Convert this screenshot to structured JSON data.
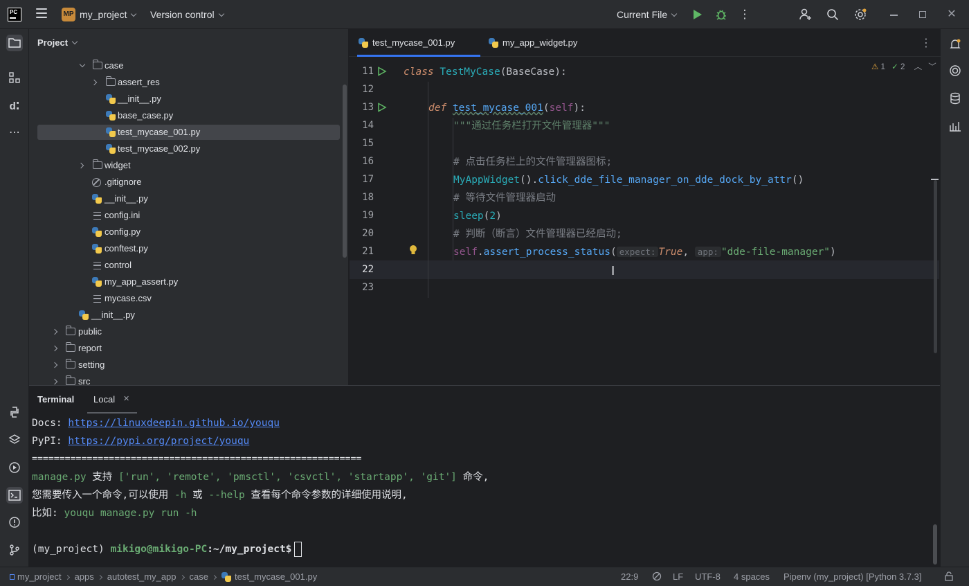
{
  "titlebar": {
    "logo": "PC",
    "project_badge": "MP",
    "project_name": "my_project",
    "vcs": "Version control",
    "run_config": "Current File"
  },
  "project_panel": {
    "title": "Project",
    "items": [
      {
        "label": "case",
        "type": "folder",
        "expanded": true
      },
      {
        "label": "assert_res",
        "type": "folder",
        "expanded": false
      },
      {
        "label": "__init__.py",
        "type": "python"
      },
      {
        "label": "base_case.py",
        "type": "python"
      },
      {
        "label": "test_mycase_001.py",
        "type": "python",
        "selected": true
      },
      {
        "label": "test_mycase_002.py",
        "type": "python"
      },
      {
        "label": "widget",
        "type": "folder",
        "expanded": false
      },
      {
        "label": ".gitignore",
        "type": "ignore"
      },
      {
        "label": "__init__.py",
        "type": "python"
      },
      {
        "label": "config.ini",
        "type": "text"
      },
      {
        "label": "config.py",
        "type": "python"
      },
      {
        "label": "conftest.py",
        "type": "python"
      },
      {
        "label": "control",
        "type": "text"
      },
      {
        "label": "my_app_assert.py",
        "type": "python"
      },
      {
        "label": "mycase.csv",
        "type": "text"
      },
      {
        "label": "__init__.py",
        "type": "python"
      },
      {
        "label": "public",
        "type": "folder",
        "expanded": false
      },
      {
        "label": "report",
        "type": "folder",
        "expanded": false
      },
      {
        "label": "setting",
        "type": "folder",
        "expanded": false
      },
      {
        "label": "src",
        "type": "folder",
        "expanded": false
      }
    ]
  },
  "editor": {
    "tabs": [
      {
        "label": "test_mycase_001.py",
        "active": true
      },
      {
        "label": "my_app_widget.py",
        "active": false
      }
    ],
    "inspection": {
      "warnings": "1",
      "weak_warnings": "2"
    },
    "line_numbers": [
      "11",
      "12",
      "13",
      "14",
      "15",
      "16",
      "17",
      "18",
      "19",
      "20",
      "21",
      "22",
      "23"
    ],
    "code": {
      "l11_kw": "class ",
      "l11_name": "TestMyCase",
      "l11_rest": "(BaseCase):",
      "l13_kw": "def ",
      "l13_name": "test_mycase_001",
      "l13_p1": "(",
      "l13_self": "self",
      "l13_p2": "):",
      "l14_doc": "\"\"\"通过任务栏打开文件管理器\"\"\"",
      "l16_cmt": "# 点击任务栏上的文件管理器图标;",
      "l17_a": "MyAppWidget",
      "l17_b": "().",
      "l17_c": "click_dde_file_manager_on_dde_dock_by_attr",
      "l17_d": "()",
      "l18_cmt": "# 等待文件管理器启动",
      "l19_a": "sleep",
      "l19_b": "(",
      "l19_num": "2",
      "l19_c": ")",
      "l20_cmt": "# 判断（断言）文件管理器已经启动;",
      "l21_self": "self",
      "l21_dot": ".",
      "l21_fn": "assert_process_status",
      "l21_p": "(",
      "l21_hint1": "expect:",
      "l21_true": "True",
      "l21_comma": ", ",
      "l21_hint2": "app:",
      "l21_str": "\"dde-file-manager\"",
      "l21_end": ")"
    }
  },
  "terminal": {
    "tab_terminal": "Terminal",
    "tab_local": "Local",
    "lines": {
      "docs_label": "Docs: ",
      "docs_url": "https://linuxdeepin.github.io/youqu",
      "pypi_label": "PyPI: ",
      "pypi_url": "https://pypi.org/project/youqu",
      "separator": "============================================================",
      "l4_a": "manage.py",
      "l4_b": " 支持 ",
      "l4_c": "['run', 'remote', 'pmsctl', 'csvctl', 'startapp', 'git']",
      "l4_d": " 命令,",
      "l5_a": "您需要传入一个命令,可以使用 ",
      "l5_b": "-h",
      "l5_c": " 或 ",
      "l5_d": "--help",
      "l5_e": " 查看每个命令参数的详细使用说明,",
      "l6_a": "比如: ",
      "l6_b": "youqu manage.py run -h",
      "prompt_env": "(my_project) ",
      "prompt_user": "mikigo@mikigo-PC",
      "prompt_path": ":~/my_project$"
    }
  },
  "statusbar": {
    "breadcrumb": [
      "my_project",
      "apps",
      "autotest_my_app",
      "case",
      "test_mycase_001.py"
    ],
    "position": "22:9",
    "line_sep": "LF",
    "encoding": "UTF-8",
    "indent": "4 spaces",
    "interpreter": "Pipenv (my_project) [Python 3.7.3]"
  },
  "colors": {
    "accent": "#3574f0",
    "keyword": "#cf8e6d",
    "function": "#56a8f5",
    "string": "#6aab73",
    "comment": "#7a7e85",
    "link": "#548af7"
  }
}
